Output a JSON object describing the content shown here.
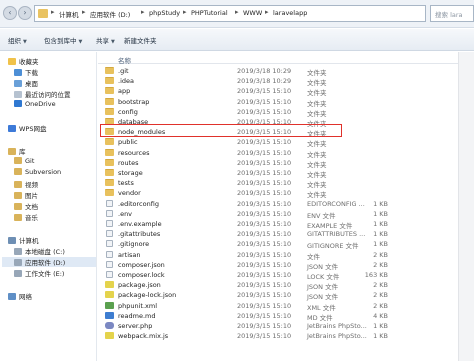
{
  "address": {
    "segments": [
      "计算机",
      "应用软件 (D:)",
      "phpStudy",
      "PHPTutorial",
      "WWW",
      "laravelapp"
    ],
    "search_placeholder": "搜索 lara"
  },
  "toolbar": {
    "organize": "组织",
    "include_in_library": "包含到库中",
    "share": "共享",
    "new_folder": "新建文件夹"
  },
  "sidebar": {
    "favorites": "收藏夹",
    "downloads": "下载",
    "desktop": "桌面",
    "recent": "最近访问的位置",
    "onedrive": "OneDrive",
    "wps": "WPS网盘",
    "libraries": "库",
    "git": "Git",
    "subversion": "Subversion",
    "videos": "视频",
    "pictures": "图片",
    "documents": "文档",
    "music": "音乐",
    "computer": "计算机",
    "local_disk": "本地磁盘 (C:)",
    "app_disk": "应用软件 (D:)",
    "work_disk": "工作文件 (E:)",
    "network": "网络"
  },
  "columns": {
    "name": "名称"
  },
  "files": [
    {
      "name": ".git",
      "date": "2019/3/18 10:29",
      "type": "文件夹",
      "size": "",
      "icon": "folder"
    },
    {
      "name": ".idea",
      "date": "2019/3/18 10:29",
      "type": "文件夹",
      "size": "",
      "icon": "folder"
    },
    {
      "name": "app",
      "date": "2019/3/15 15:10",
      "type": "文件夹",
      "size": "",
      "icon": "folder"
    },
    {
      "name": "bootstrap",
      "date": "2019/3/15 15:10",
      "type": "文件夹",
      "size": "",
      "icon": "folder"
    },
    {
      "name": "config",
      "date": "2019/3/15 15:10",
      "type": "文件夹",
      "size": "",
      "icon": "folder"
    },
    {
      "name": "database",
      "date": "2019/3/15 15:10",
      "type": "文件夹",
      "size": "",
      "icon": "folder"
    },
    {
      "name": "node_modules",
      "date": "2019/3/15 15:10",
      "type": "文件夹",
      "size": "",
      "icon": "folder"
    },
    {
      "name": "public",
      "date": "2019/3/15 15:10",
      "type": "文件夹",
      "size": "",
      "icon": "folder"
    },
    {
      "name": "resources",
      "date": "2019/3/15 15:10",
      "type": "文件夹",
      "size": "",
      "icon": "folder"
    },
    {
      "name": "routes",
      "date": "2019/3/15 15:10",
      "type": "文件夹",
      "size": "",
      "icon": "folder"
    },
    {
      "name": "storage",
      "date": "2019/3/15 15:10",
      "type": "文件夹",
      "size": "",
      "icon": "folder"
    },
    {
      "name": "tests",
      "date": "2019/3/15 15:10",
      "type": "文件夹",
      "size": "",
      "icon": "folder"
    },
    {
      "name": "vendor",
      "date": "2019/3/15 15:10",
      "type": "文件夹",
      "size": "",
      "icon": "folder"
    },
    {
      "name": ".editorconfig",
      "date": "2019/3/15 15:10",
      "type": "EDITORCONFIG ...",
      "size": "1 KB",
      "icon": "file"
    },
    {
      "name": ".env",
      "date": "2019/3/15 15:10",
      "type": "ENV 文件",
      "size": "1 KB",
      "icon": "file"
    },
    {
      "name": ".env.example",
      "date": "2019/3/15 15:10",
      "type": "EXAMPLE 文件",
      "size": "1 KB",
      "icon": "file"
    },
    {
      "name": ".gitattributes",
      "date": "2019/3/15 15:10",
      "type": "GITATTRIBUTES ...",
      "size": "1 KB",
      "icon": "file"
    },
    {
      "name": ".gitignore",
      "date": "2019/3/15 15:10",
      "type": "GITIGNORE 文件",
      "size": "1 KB",
      "icon": "file"
    },
    {
      "name": "artisan",
      "date": "2019/3/15 15:10",
      "type": "文件",
      "size": "2 KB",
      "icon": "file"
    },
    {
      "name": "composer.json",
      "date": "2019/3/15 15:10",
      "type": "JSON 文件",
      "size": "2 KB",
      "icon": "file"
    },
    {
      "name": "composer.lock",
      "date": "2019/3/15 15:10",
      "type": "LOCK 文件",
      "size": "163 KB",
      "icon": "file"
    },
    {
      "name": "package.json",
      "date": "2019/3/15 15:10",
      "type": "JSON 文件",
      "size": "2 KB",
      "icon": "js"
    },
    {
      "name": "package-lock.json",
      "date": "2019/3/15 15:10",
      "type": "JSON 文件",
      "size": "2 KB",
      "icon": "js"
    },
    {
      "name": "phpunit.xml",
      "date": "2019/3/15 15:10",
      "type": "XML 文件",
      "size": "2 KB",
      "icon": "xml"
    },
    {
      "name": "readme.md",
      "date": "2019/3/15 15:10",
      "type": "MD 文件",
      "size": "4 KB",
      "icon": "md"
    },
    {
      "name": "server.php",
      "date": "2019/3/15 15:10",
      "type": "JetBrains PhpSto...",
      "size": "1 KB",
      "icon": "php"
    },
    {
      "name": "webpack.mix.js",
      "date": "2019/3/15 15:10",
      "type": "JetBrains PhpSto...",
      "size": "1 KB",
      "icon": "js"
    }
  ],
  "accent_colors": {
    "highlight_border": "#e0312b",
    "folder": "#e8c15d"
  }
}
